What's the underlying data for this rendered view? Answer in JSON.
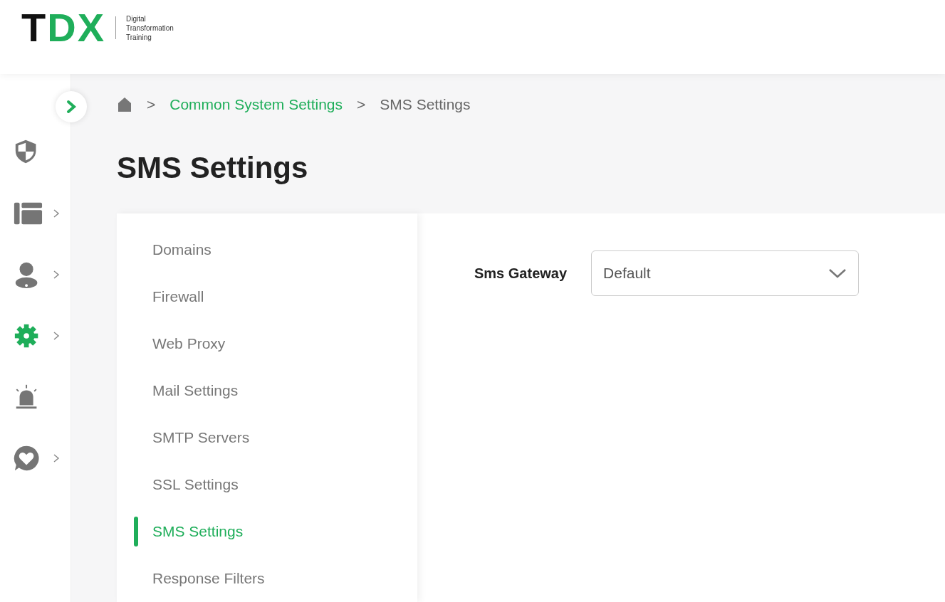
{
  "logo": {
    "mark_dark": "T",
    "mark_accent": "DX",
    "tagline": [
      "Digital",
      "Transformation",
      "Training"
    ]
  },
  "sidebar": {
    "items": [
      {
        "kind": "shield",
        "selected": false,
        "expandable": false
      },
      {
        "kind": "layout",
        "selected": false,
        "expandable": true
      },
      {
        "kind": "user",
        "selected": false,
        "expandable": true
      },
      {
        "kind": "gear",
        "selected": true,
        "expandable": true
      },
      {
        "kind": "alarm",
        "selected": false,
        "expandable": false
      },
      {
        "kind": "heart",
        "selected": false,
        "expandable": true
      }
    ]
  },
  "breadcrumb": {
    "items": [
      {
        "label": "Common System Settings",
        "link": true
      },
      {
        "label": "SMS Settings",
        "link": false
      }
    ],
    "separator": ">"
  },
  "page_title": "SMS Settings",
  "menu": [
    {
      "label": "Domains",
      "selected": false
    },
    {
      "label": "Firewall",
      "selected": false
    },
    {
      "label": "Web Proxy",
      "selected": false
    },
    {
      "label": "Mail Settings",
      "selected": false
    },
    {
      "label": "SMTP Servers",
      "selected": false
    },
    {
      "label": "SSL Settings",
      "selected": false
    },
    {
      "label": "SMS Settings",
      "selected": true
    },
    {
      "label": "Response Filters",
      "selected": false
    }
  ],
  "form": {
    "label": "Sms Gateway",
    "value": "Default"
  }
}
